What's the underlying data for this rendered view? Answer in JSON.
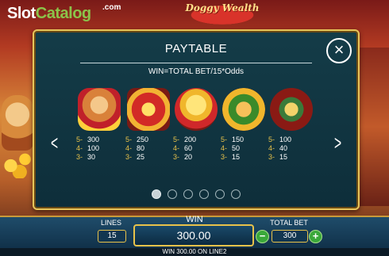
{
  "branding": {
    "site_logo_slot": "Slot",
    "site_logo_catalog": "Catalog",
    "site_logo_com": ".com",
    "game_title": "Doggy Wealth"
  },
  "paytable": {
    "title": "PAYTABLE",
    "formula": "WIN=TOTAL BET/15*Odds",
    "symbols": [
      {
        "icon": "dog-wild-icon",
        "pays": [
          {
            "k": "5-",
            "v": "300"
          },
          {
            "k": "4-",
            "v": "100"
          },
          {
            "k": "3-",
            "v": "30"
          }
        ]
      },
      {
        "icon": "treasure-chest-icon",
        "pays": [
          {
            "k": "5-",
            "v": "250"
          },
          {
            "k": "4-",
            "v": "80"
          },
          {
            "k": "3-",
            "v": "25"
          }
        ]
      },
      {
        "icon": "gold-bowl-icon",
        "pays": [
          {
            "k": "5-",
            "v": "200"
          },
          {
            "k": "4-",
            "v": "60"
          },
          {
            "k": "3-",
            "v": "20"
          }
        ]
      },
      {
        "icon": "dog-toy-icon",
        "pays": [
          {
            "k": "5-",
            "v": "150"
          },
          {
            "k": "4-",
            "v": "50"
          },
          {
            "k": "3-",
            "v": "15"
          }
        ]
      },
      {
        "icon": "bone-icon",
        "pays": [
          {
            "k": "5-",
            "v": "100"
          },
          {
            "k": "4-",
            "v": "40"
          },
          {
            "k": "3-",
            "v": "15"
          }
        ]
      }
    ],
    "page_count": 6,
    "active_page": 1
  },
  "bottom_bar": {
    "lines_label": "LINES",
    "lines_value": "15",
    "win_label": "WIN",
    "win_value": "300.00",
    "total_bet_label": "TOTAL BET",
    "total_bet_value": "300",
    "minus_symbol": "−",
    "plus_symbol": "+"
  },
  "status_text": "WIN 300.00 ON LINE2",
  "colors": {
    "panel_border": "#e8c65a",
    "pay_key": "#e8c24a",
    "bet_button": "#3aa83a"
  }
}
